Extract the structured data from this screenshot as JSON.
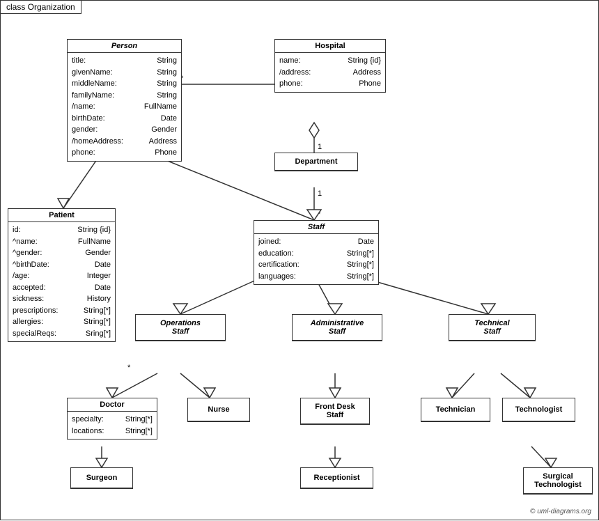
{
  "title": "class Organization",
  "copyright": "© uml-diagrams.org",
  "classes": {
    "person": {
      "name": "Person",
      "attrs": [
        {
          "name": "title:",
          "type": "String"
        },
        {
          "name": "givenName:",
          "type": "String"
        },
        {
          "name": "middleName:",
          "type": "String"
        },
        {
          "name": "familyName:",
          "type": "String"
        },
        {
          "name": "/name:",
          "type": "FullName"
        },
        {
          "name": "birthDate:",
          "type": "Date"
        },
        {
          "name": "gender:",
          "type": "Gender"
        },
        {
          "name": "/homeAddress:",
          "type": "Address"
        },
        {
          "name": "phone:",
          "type": "Phone"
        }
      ]
    },
    "hospital": {
      "name": "Hospital",
      "attrs": [
        {
          "name": "name:",
          "type": "String {id}"
        },
        {
          "name": "/address:",
          "type": "Address"
        },
        {
          "name": "phone:",
          "type": "Phone"
        }
      ]
    },
    "patient": {
      "name": "Patient",
      "attrs": [
        {
          "name": "id:",
          "type": "String {id}"
        },
        {
          "name": "^name:",
          "type": "FullName"
        },
        {
          "name": "^gender:",
          "type": "Gender"
        },
        {
          "name": "^birthDate:",
          "type": "Date"
        },
        {
          "name": "/age:",
          "type": "Integer"
        },
        {
          "name": "accepted:",
          "type": "Date"
        },
        {
          "name": "sickness:",
          "type": "History"
        },
        {
          "name": "prescriptions:",
          "type": "String[*]"
        },
        {
          "name": "allergies:",
          "type": "String[*]"
        },
        {
          "name": "specialReqs:",
          "type": "Sring[*]"
        }
      ]
    },
    "department": {
      "name": "Department"
    },
    "staff": {
      "name": "Staff",
      "attrs": [
        {
          "name": "joined:",
          "type": "Date"
        },
        {
          "name": "education:",
          "type": "String[*]"
        },
        {
          "name": "certification:",
          "type": "String[*]"
        },
        {
          "name": "languages:",
          "type": "String[*]"
        }
      ]
    },
    "operations_staff": {
      "name": "Operations\nStaff"
    },
    "administrative_staff": {
      "name": "Administrative\nStaff"
    },
    "technical_staff": {
      "name": "Technical\nStaff"
    },
    "doctor": {
      "name": "Doctor",
      "attrs": [
        {
          "name": "specialty:",
          "type": "String[*]"
        },
        {
          "name": "locations:",
          "type": "String[*]"
        }
      ]
    },
    "nurse": {
      "name": "Nurse"
    },
    "front_desk_staff": {
      "name": "Front Desk\nStaff"
    },
    "technician": {
      "name": "Technician"
    },
    "technologist": {
      "name": "Technologist"
    },
    "surgeon": {
      "name": "Surgeon"
    },
    "receptionist": {
      "name": "Receptionist"
    },
    "surgical_technologist": {
      "name": "Surgical\nTechnologist"
    }
  }
}
